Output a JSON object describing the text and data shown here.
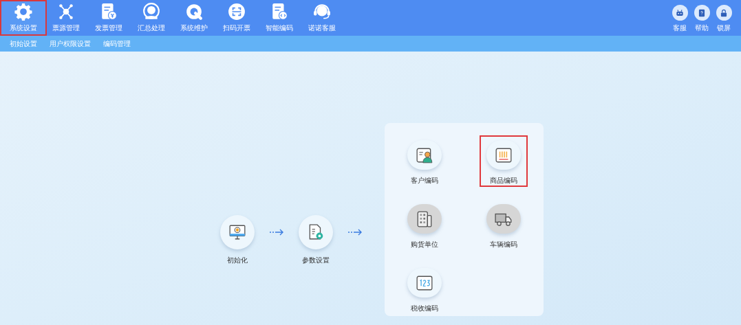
{
  "top_nav": [
    {
      "label": "系统设置",
      "kind": "gear",
      "selected": true
    },
    {
      "label": "票源管理",
      "kind": "network",
      "selected": false
    },
    {
      "label": "发票管理",
      "kind": "invoice",
      "selected": false
    },
    {
      "label": "汇总处理",
      "kind": "tax",
      "selected": false
    },
    {
      "label": "系统维护",
      "kind": "wrench",
      "selected": false
    },
    {
      "label": "扫码开票",
      "kind": "scan",
      "selected": false
    },
    {
      "label": "智能编码",
      "kind": "code",
      "selected": false
    },
    {
      "label": "诺诺客服",
      "kind": "headset",
      "selected": false
    }
  ],
  "right_tools": [
    {
      "label": "客服",
      "kind": "robot"
    },
    {
      "label": "帮助",
      "kind": "help"
    },
    {
      "label": "锁屏",
      "kind": "lock"
    }
  ],
  "sub_nav": [
    "初始设置",
    "用户权限设置",
    "编码管理"
  ],
  "workflow": [
    {
      "label": "初始化",
      "kind": "monitor"
    },
    {
      "label": "参数设置",
      "kind": "document"
    }
  ],
  "code_items": [
    {
      "label": "客户编码",
      "kind": "person",
      "enabled": true,
      "selected": false
    },
    {
      "label": "商品编码",
      "kind": "barcode",
      "enabled": true,
      "selected": true
    },
    {
      "label": "购货单位",
      "kind": "building",
      "enabled": false,
      "selected": false
    },
    {
      "label": "车辆编码",
      "kind": "truck",
      "enabled": false,
      "selected": false
    },
    {
      "label": "税收编码",
      "kind": "numbers",
      "enabled": true,
      "selected": false
    }
  ]
}
